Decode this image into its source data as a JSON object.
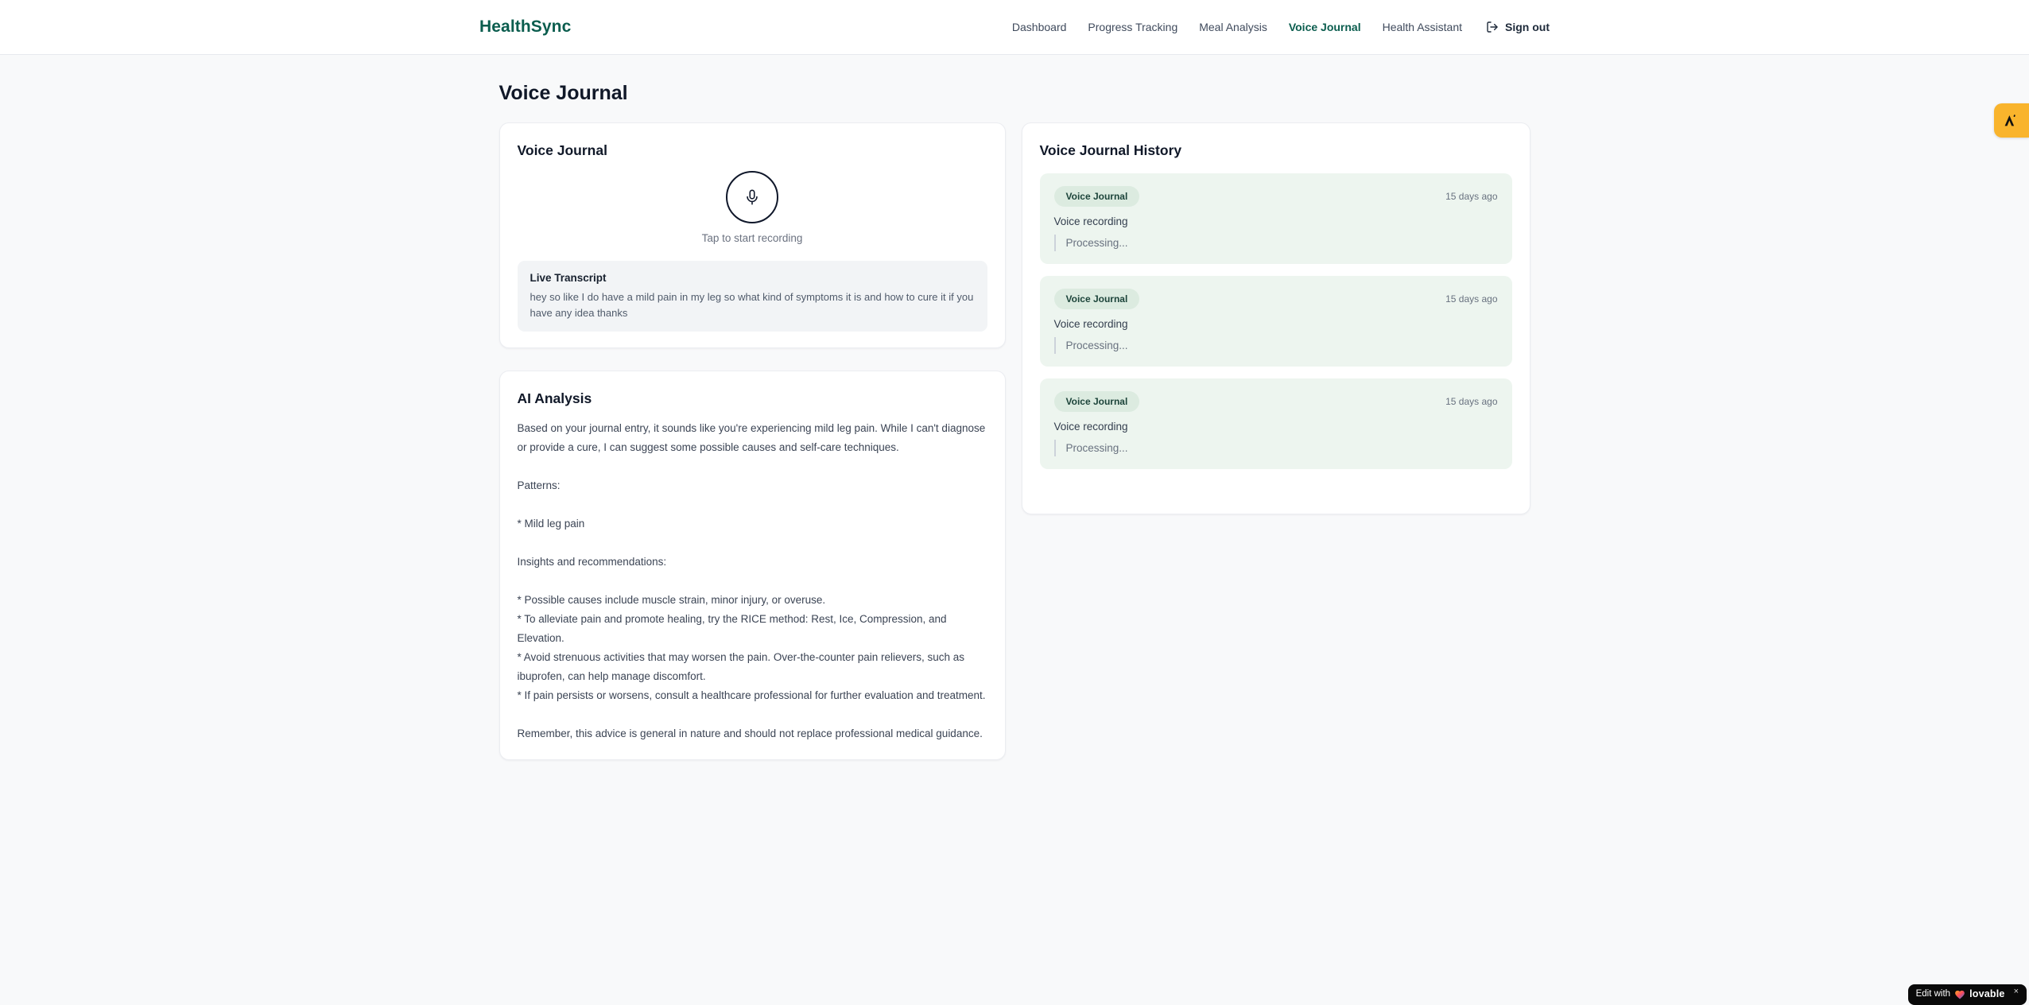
{
  "header": {
    "logo": "HealthSync",
    "nav_items": [
      {
        "label": "Dashboard",
        "active": false
      },
      {
        "label": "Progress Tracking",
        "active": false
      },
      {
        "label": "Meal Analysis",
        "active": false
      },
      {
        "label": "Voice Journal",
        "active": true
      },
      {
        "label": "Health Assistant",
        "active": false
      }
    ],
    "sign_out_label": "Sign out"
  },
  "page": {
    "title": "Voice Journal"
  },
  "recorder": {
    "card_title": "Voice Journal",
    "mic_icon": "microphone-icon",
    "tap_hint": "Tap to start recording",
    "transcript_title": "Live Transcript",
    "transcript_text": "hey so like I do have a mild pain in my leg so what kind of symptoms it is and how to cure it if you have any idea thanks"
  },
  "ai_analysis": {
    "card_title": "AI Analysis",
    "body": "Based on your journal entry, it sounds like you're experiencing mild leg pain. While I can't diagnose or provide a cure, I can suggest some possible causes and self-care techniques.\n\nPatterns:\n\n* Mild leg pain\n\nInsights and recommendations:\n\n* Possible causes include muscle strain, minor injury, or overuse.\n* To alleviate pain and promote healing, try the RICE method: Rest, Ice, Compression, and Elevation.\n* Avoid strenuous activities that may worsen the pain. Over-the-counter pain relievers, such as ibuprofen, can help manage discomfort.\n* If pain persists or worsens, consult a healthcare professional for further evaluation and treatment.\n\nRemember, this advice is general in nature and should not replace professional medical guidance."
  },
  "history": {
    "card_title": "Voice Journal History",
    "entries": [
      {
        "badge": "Voice Journal",
        "time": "15 days ago",
        "title": "Voice recording",
        "status": "Processing..."
      },
      {
        "badge": "Voice Journal",
        "time": "15 days ago",
        "title": "Voice recording",
        "status": "Processing..."
      },
      {
        "badge": "Voice Journal",
        "time": "15 days ago",
        "title": "Voice recording",
        "status": "Processing..."
      }
    ]
  },
  "floating": {
    "edit_badge": {
      "prefix": "Edit with",
      "brand": "lovable",
      "close": "×"
    }
  },
  "colors": {
    "accent_teal": "#0b5d4e",
    "page_background": "#f8f9fa",
    "history_entry_background": "#edf5ef",
    "badge_background": "#dcebe0",
    "corner_badge_amber": "#f9b42c",
    "lovable_badge_black": "#0a0a0a"
  }
}
